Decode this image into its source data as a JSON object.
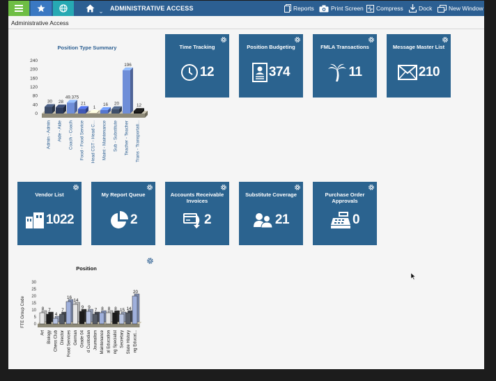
{
  "toolbar": {
    "title": "ADMINISTRATIVE ACCESS",
    "actions": [
      {
        "label": "Reports",
        "icon": "reports-icon"
      },
      {
        "label": "Print Screen",
        "icon": "camera-icon"
      },
      {
        "label": "Compress",
        "icon": "compress-icon"
      },
      {
        "label": "Dock",
        "icon": "dock-icon"
      },
      {
        "label": "New Window",
        "icon": "new-window-icon"
      }
    ],
    "colors": {
      "bar": "#2c5f92",
      "menu": "#6ebe44",
      "favorites": "#3a78c2",
      "globe": "#27a9b3"
    }
  },
  "breadcrumb": "Administrative Access",
  "tiles": [
    {
      "title": "Time Tracking",
      "count": "12",
      "icon": "clock-icon"
    },
    {
      "title": "Position Budgeting",
      "count": "374",
      "icon": "id-card-icon"
    },
    {
      "title": "FMLA Transactions",
      "count": "11",
      "icon": "palm-tree-icon"
    },
    {
      "title": "Message Master List",
      "count": "210",
      "icon": "envelope-icon"
    },
    {
      "title": "Vendor List",
      "count": "1022",
      "icon": "buildings-icon"
    },
    {
      "title": "My Report Queue",
      "count": "2",
      "icon": "pie-chart-icon"
    },
    {
      "title": "Accounts Receivable Invoices",
      "count": "2",
      "icon": "invoice-icon"
    },
    {
      "title": "Substitute Coverage",
      "count": "21",
      "icon": "users-icon"
    },
    {
      "title": "Purchase Order Approvals",
      "count": "0",
      "icon": "cash-register-icon"
    }
  ],
  "tile_color": "#2b638f",
  "chart_data": [
    {
      "type": "bar",
      "title": "Position Type Summary",
      "categories": [
        "Admin - Admin",
        "Aide - Aide",
        "Coach - Coach",
        "Food - Food Service",
        "Head CST - Head C...",
        "Maint - Maintenance",
        "Sub - Substitute",
        "Teacher - Teacher",
        "Trans - Transportati..."
      ],
      "values": [
        30,
        28,
        49.375,
        21,
        1,
        16,
        20,
        196,
        12
      ],
      "value_labels": [
        "30",
        "28",
        "49.375",
        "21",
        "1",
        "16",
        "20",
        "196",
        "12"
      ],
      "bar_colors": [
        "#3b4a66",
        "#2e3c5c",
        "#6f8ed8",
        "#3f58b5",
        "#c9c0a8",
        "#5577cf",
        "#3e4f6a",
        "#6f8ed8",
        "#151515"
      ],
      "yticks": [
        "240",
        "200",
        "160",
        "120",
        "80",
        "40",
        "0"
      ],
      "ylim": [
        0,
        240
      ]
    },
    {
      "type": "bar",
      "title": "Position",
      "ylabel": "FTE Group Code",
      "yticks": [
        "30",
        "25",
        "20",
        "15",
        "10",
        "5",
        "0"
      ],
      "ylim": [
        0,
        30
      ],
      "categories": [
        "Art",
        "Biology",
        "Chess Club",
        "Director",
        "Food Services",
        "German",
        "Grade 04",
        "d Custodian",
        "Journalism",
        "Maintenance",
        "al Education",
        "ng Specialist",
        "Secretary",
        "State History",
        "ng Educat..."
      ],
      "values": [
        8,
        7,
        4,
        7,
        16,
        14,
        9,
        9,
        7,
        8,
        8,
        8,
        7,
        8,
        20
      ],
      "value_labels": [
        "8",
        "7",
        "4",
        "7",
        "16",
        "14",
        "9",
        "9",
        "7",
        "8",
        "8",
        "8",
        "15",
        "14",
        "20"
      ]
    }
  ]
}
